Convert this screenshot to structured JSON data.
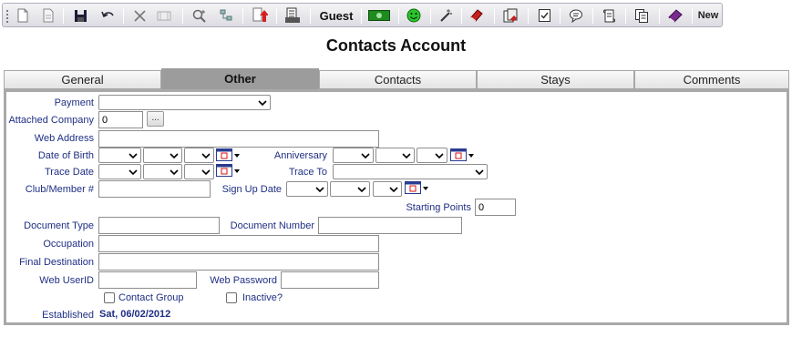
{
  "toolbar": {
    "guest_label": "Guest",
    "new_label": "New",
    "icons": [
      "new-document-icon",
      "copy-document-icon",
      "save-icon",
      "undo-icon",
      "delete-icon",
      "folder-icon",
      "search-icon",
      "flowchart-icon",
      "upload-icon",
      "print-list-icon",
      "guest",
      "money-icon",
      "smiley-icon",
      "magic-wand-icon",
      "red-book-icon",
      "stack-icon",
      "checklist-icon",
      "speech-bubble-icon",
      "scroll-icon",
      "copy-pages-icon",
      "purple-book-icon",
      "new"
    ]
  },
  "page": {
    "title": "Contacts Account"
  },
  "tabs": [
    {
      "label": "General"
    },
    {
      "label": "Other"
    },
    {
      "label": "Contacts"
    },
    {
      "label": "Stays"
    },
    {
      "label": "Comments"
    }
  ],
  "form": {
    "payment_label": "Payment",
    "attached_company_label": "Attached Company",
    "attached_company_value": "0",
    "attached_company_browse": "...",
    "web_address_label": "Web Address",
    "date_of_birth_label": "Date of Birth",
    "anniversary_label": "Anniversary",
    "trace_date_label": "Trace Date",
    "trace_to_label": "Trace To",
    "club_member_label": "Club/Member #",
    "sign_up_date_label": "Sign Up Date",
    "starting_points_label": "Starting Points",
    "starting_points_value": "0",
    "document_type_label": "Document Type",
    "document_number_label": "Document Number",
    "occupation_label": "Occupation",
    "final_destination_label": "Final Destination",
    "web_userid_label": "Web UserID",
    "web_password_label": "Web Password",
    "contact_group_label": "Contact Group",
    "inactive_label": "Inactive?",
    "established_label": "Established",
    "established_value": "Sat, 06/02/2012"
  },
  "colors": {
    "label": "#1f2f84",
    "active_tab": "#9c9c9c",
    "panel_border": "#a9a9a9"
  }
}
